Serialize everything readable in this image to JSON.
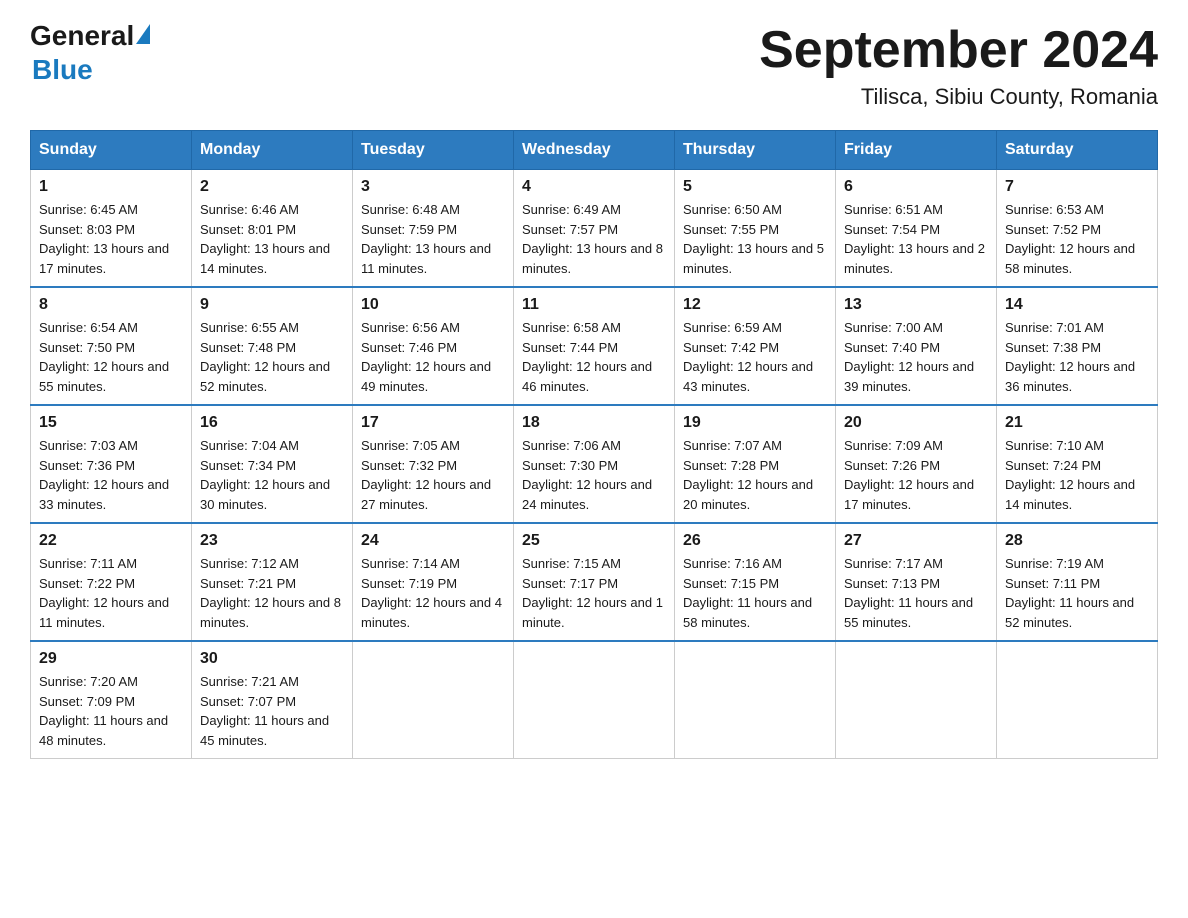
{
  "header": {
    "logo_general": "General",
    "logo_blue": "Blue",
    "month_title": "September 2024",
    "location": "Tilisca, Sibiu County, Romania"
  },
  "weekdays": [
    "Sunday",
    "Monday",
    "Tuesday",
    "Wednesday",
    "Thursday",
    "Friday",
    "Saturday"
  ],
  "weeks": [
    [
      {
        "day": "1",
        "sunrise": "6:45 AM",
        "sunset": "8:03 PM",
        "daylight": "13 hours and 17 minutes."
      },
      {
        "day": "2",
        "sunrise": "6:46 AM",
        "sunset": "8:01 PM",
        "daylight": "13 hours and 14 minutes."
      },
      {
        "day": "3",
        "sunrise": "6:48 AM",
        "sunset": "7:59 PM",
        "daylight": "13 hours and 11 minutes."
      },
      {
        "day": "4",
        "sunrise": "6:49 AM",
        "sunset": "7:57 PM",
        "daylight": "13 hours and 8 minutes."
      },
      {
        "day": "5",
        "sunrise": "6:50 AM",
        "sunset": "7:55 PM",
        "daylight": "13 hours and 5 minutes."
      },
      {
        "day": "6",
        "sunrise": "6:51 AM",
        "sunset": "7:54 PM",
        "daylight": "13 hours and 2 minutes."
      },
      {
        "day": "7",
        "sunrise": "6:53 AM",
        "sunset": "7:52 PM",
        "daylight": "12 hours and 58 minutes."
      }
    ],
    [
      {
        "day": "8",
        "sunrise": "6:54 AM",
        "sunset": "7:50 PM",
        "daylight": "12 hours and 55 minutes."
      },
      {
        "day": "9",
        "sunrise": "6:55 AM",
        "sunset": "7:48 PM",
        "daylight": "12 hours and 52 minutes."
      },
      {
        "day": "10",
        "sunrise": "6:56 AM",
        "sunset": "7:46 PM",
        "daylight": "12 hours and 49 minutes."
      },
      {
        "day": "11",
        "sunrise": "6:58 AM",
        "sunset": "7:44 PM",
        "daylight": "12 hours and 46 minutes."
      },
      {
        "day": "12",
        "sunrise": "6:59 AM",
        "sunset": "7:42 PM",
        "daylight": "12 hours and 43 minutes."
      },
      {
        "day": "13",
        "sunrise": "7:00 AM",
        "sunset": "7:40 PM",
        "daylight": "12 hours and 39 minutes."
      },
      {
        "day": "14",
        "sunrise": "7:01 AM",
        "sunset": "7:38 PM",
        "daylight": "12 hours and 36 minutes."
      }
    ],
    [
      {
        "day": "15",
        "sunrise": "7:03 AM",
        "sunset": "7:36 PM",
        "daylight": "12 hours and 33 minutes."
      },
      {
        "day": "16",
        "sunrise": "7:04 AM",
        "sunset": "7:34 PM",
        "daylight": "12 hours and 30 minutes."
      },
      {
        "day": "17",
        "sunrise": "7:05 AM",
        "sunset": "7:32 PM",
        "daylight": "12 hours and 27 minutes."
      },
      {
        "day": "18",
        "sunrise": "7:06 AM",
        "sunset": "7:30 PM",
        "daylight": "12 hours and 24 minutes."
      },
      {
        "day": "19",
        "sunrise": "7:07 AM",
        "sunset": "7:28 PM",
        "daylight": "12 hours and 20 minutes."
      },
      {
        "day": "20",
        "sunrise": "7:09 AM",
        "sunset": "7:26 PM",
        "daylight": "12 hours and 17 minutes."
      },
      {
        "day": "21",
        "sunrise": "7:10 AM",
        "sunset": "7:24 PM",
        "daylight": "12 hours and 14 minutes."
      }
    ],
    [
      {
        "day": "22",
        "sunrise": "7:11 AM",
        "sunset": "7:22 PM",
        "daylight": "12 hours and 11 minutes."
      },
      {
        "day": "23",
        "sunrise": "7:12 AM",
        "sunset": "7:21 PM",
        "daylight": "12 hours and 8 minutes."
      },
      {
        "day": "24",
        "sunrise": "7:14 AM",
        "sunset": "7:19 PM",
        "daylight": "12 hours and 4 minutes."
      },
      {
        "day": "25",
        "sunrise": "7:15 AM",
        "sunset": "7:17 PM",
        "daylight": "12 hours and 1 minute."
      },
      {
        "day": "26",
        "sunrise": "7:16 AM",
        "sunset": "7:15 PM",
        "daylight": "11 hours and 58 minutes."
      },
      {
        "day": "27",
        "sunrise": "7:17 AM",
        "sunset": "7:13 PM",
        "daylight": "11 hours and 55 minutes."
      },
      {
        "day": "28",
        "sunrise": "7:19 AM",
        "sunset": "7:11 PM",
        "daylight": "11 hours and 52 minutes."
      }
    ],
    [
      {
        "day": "29",
        "sunrise": "7:20 AM",
        "sunset": "7:09 PM",
        "daylight": "11 hours and 48 minutes."
      },
      {
        "day": "30",
        "sunrise": "7:21 AM",
        "sunset": "7:07 PM",
        "daylight": "11 hours and 45 minutes."
      },
      null,
      null,
      null,
      null,
      null
    ]
  ],
  "labels": {
    "sunrise": "Sunrise:",
    "sunset": "Sunset:",
    "daylight": "Daylight:"
  }
}
